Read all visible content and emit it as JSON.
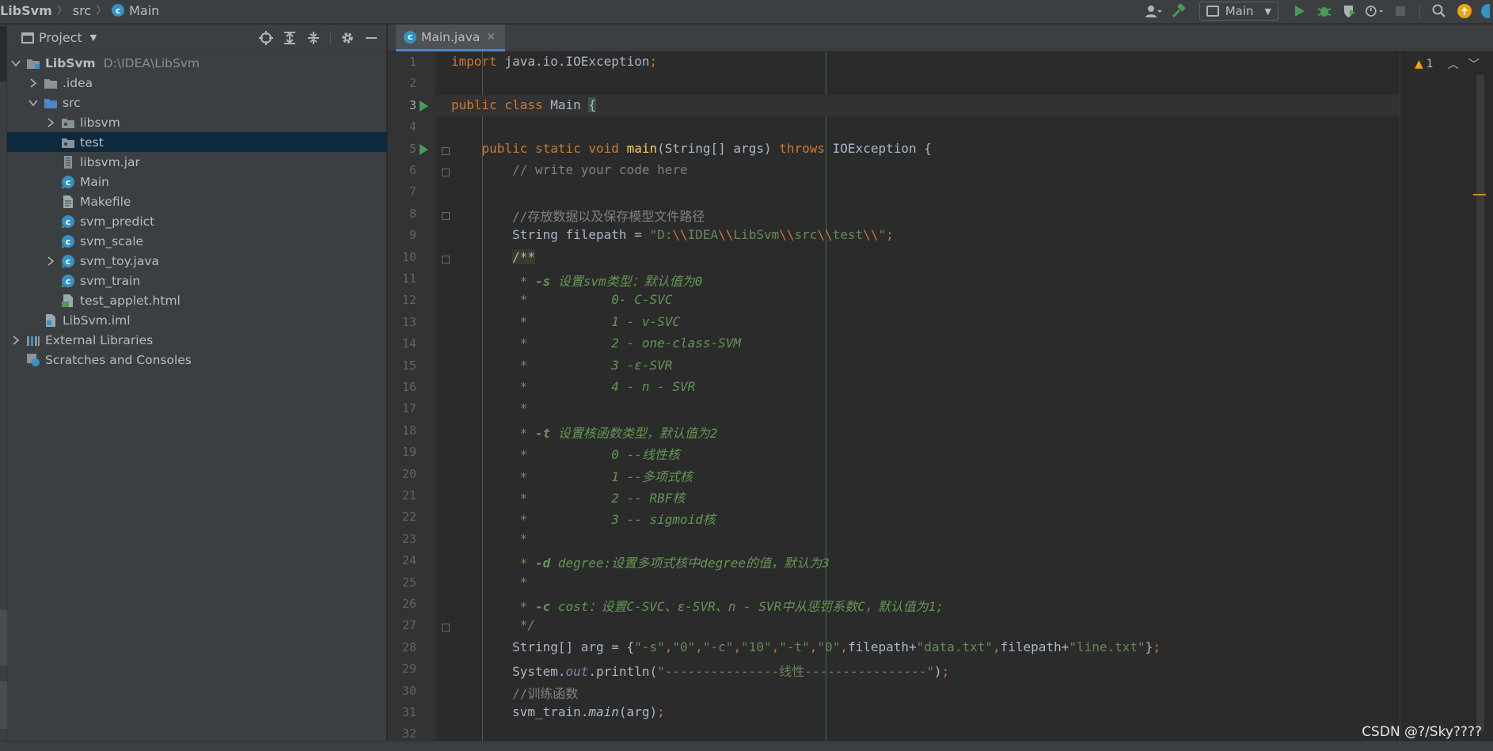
{
  "breadcrumb": {
    "project": "LibSvm",
    "folder": "src",
    "file": "Main"
  },
  "toolbar": {
    "run_config": "Main",
    "colors": {
      "run": "#499c54",
      "debug": "#499c54",
      "build": "#499c54",
      "update": "#f0a30a"
    }
  },
  "project_panel": {
    "title": "Project",
    "tree": [
      {
        "label": "LibSvm",
        "sub": "D:\\IDEA\\LibSvm",
        "depth": 0,
        "arrow": "down",
        "icon": "folder-module-icon",
        "bold": true
      },
      {
        "label": ".idea",
        "depth": 1,
        "arrow": "right",
        "icon": "folder-icon"
      },
      {
        "label": "src",
        "depth": 1,
        "arrow": "down",
        "icon": "source-folder-icon"
      },
      {
        "label": "libsvm",
        "depth": 2,
        "arrow": "right",
        "icon": "package-icon"
      },
      {
        "label": "test",
        "depth": 2,
        "arrow": "",
        "icon": "package-icon",
        "selected": true
      },
      {
        "label": "libsvm.jar",
        "depth": 2,
        "arrow": "",
        "icon": "jar-icon"
      },
      {
        "label": "Main",
        "depth": 2,
        "arrow": "",
        "icon": "java-class-icon"
      },
      {
        "label": "Makefile",
        "depth": 2,
        "arrow": "",
        "icon": "text-file-icon"
      },
      {
        "label": "svm_predict",
        "depth": 2,
        "arrow": "",
        "icon": "java-class-icon"
      },
      {
        "label": "svm_scale",
        "depth": 2,
        "arrow": "",
        "icon": "java-class-icon"
      },
      {
        "label": "svm_toy.java",
        "depth": 2,
        "arrow": "right",
        "icon": "java-class-icon"
      },
      {
        "label": "svm_train",
        "depth": 2,
        "arrow": "",
        "icon": "java-class-icon"
      },
      {
        "label": "test_applet.html",
        "depth": 2,
        "arrow": "",
        "icon": "html-file-icon"
      },
      {
        "label": "LibSvm.iml",
        "depth": 1,
        "arrow": "",
        "icon": "iml-file-icon"
      },
      {
        "label": "External Libraries",
        "depth": 0,
        "arrow": "right",
        "icon": "library-icon"
      },
      {
        "label": "Scratches and Consoles",
        "depth": 0,
        "arrow": "",
        "icon": "scratches-icon"
      }
    ]
  },
  "editor": {
    "tab": "Main.java",
    "warnings": "1",
    "current_line": 3,
    "lines": [
      [
        [
          "kw",
          "import "
        ],
        [
          "",
          "java.io.IOException"
        ],
        [
          "kw",
          ";"
        ]
      ],
      [],
      [
        [
          "kw",
          "public class "
        ],
        [
          "",
          "Main "
        ],
        [
          "hl",
          "{"
        ]
      ],
      [],
      [
        [
          "",
          "    "
        ],
        [
          "kw",
          "public static void "
        ],
        [
          "fn",
          "main"
        ],
        [
          "",
          "(String[] args) "
        ],
        [
          "kw",
          "throws "
        ],
        [
          "",
          "IOException {"
        ]
      ],
      [
        [
          "",
          "        "
        ],
        [
          "cmt",
          "// write your code here"
        ]
      ],
      [],
      [
        [
          "",
          "        "
        ],
        [
          "cmt",
          "//存放数据以及保存模型文件路径"
        ]
      ],
      [
        [
          "",
          "        String filepath = "
        ],
        [
          "str",
          "\"D:"
        ],
        [
          "esc",
          "\\\\"
        ],
        [
          "str",
          "IDEA"
        ],
        [
          "esc",
          "\\\\"
        ],
        [
          "str",
          "LibSvm"
        ],
        [
          "esc",
          "\\\\"
        ],
        [
          "str",
          "src"
        ],
        [
          "esc",
          "\\\\"
        ],
        [
          "str",
          "test"
        ],
        [
          "esc",
          "\\\\"
        ],
        [
          "str",
          "\""
        ],
        [
          "kw",
          ";"
        ]
      ],
      [
        [
          "",
          "        "
        ],
        [
          "dochl",
          "/**"
        ]
      ],
      [
        [
          "",
          "         "
        ],
        [
          "doc",
          "* "
        ],
        [
          "doct",
          "-s"
        ],
        [
          "doc",
          " 设置svm类型：默认值为0"
        ]
      ],
      [
        [
          "",
          "         "
        ],
        [
          "doc",
          "*           0- C-SVC"
        ]
      ],
      [
        [
          "",
          "         "
        ],
        [
          "doc",
          "*           1 - v-SVC"
        ]
      ],
      [
        [
          "",
          "         "
        ],
        [
          "doc",
          "*           2 - one-class-SVM"
        ]
      ],
      [
        [
          "",
          "         "
        ],
        [
          "doc",
          "*           3 -ε-SVR"
        ]
      ],
      [
        [
          "",
          "         "
        ],
        [
          "doc",
          "*           4 - n - SVR"
        ]
      ],
      [
        [
          "",
          "         "
        ],
        [
          "doc",
          "*"
        ]
      ],
      [
        [
          "",
          "         "
        ],
        [
          "doc",
          "* "
        ],
        [
          "doct",
          "-t"
        ],
        [
          "doc",
          " 设置核函数类型，默认值为2"
        ]
      ],
      [
        [
          "",
          "         "
        ],
        [
          "doc",
          "*           0 --线性核"
        ]
      ],
      [
        [
          "",
          "         "
        ],
        [
          "doc",
          "*           1 --多项式核"
        ]
      ],
      [
        [
          "",
          "         "
        ],
        [
          "doc",
          "*           2 -- RBF核"
        ]
      ],
      [
        [
          "",
          "         "
        ],
        [
          "doc",
          "*           3 -- sigmoid核"
        ]
      ],
      [
        [
          "",
          "         "
        ],
        [
          "doc",
          "*"
        ]
      ],
      [
        [
          "",
          "         "
        ],
        [
          "doc",
          "* "
        ],
        [
          "doct",
          "-d"
        ],
        [
          "doc",
          " degree:设置多项式核中degree的值，默认为3"
        ]
      ],
      [
        [
          "",
          "         "
        ],
        [
          "doc",
          "*"
        ]
      ],
      [
        [
          "",
          "         "
        ],
        [
          "doc",
          "* "
        ],
        [
          "doct",
          "-c"
        ],
        [
          "doc",
          " cost：设置C-SVC、ε-SVR、n - SVR中从惩罚系数C，默认值为1;"
        ]
      ],
      [
        [
          "",
          "         "
        ],
        [
          "doc",
          "*/"
        ]
      ],
      [
        [
          "",
          "        String[] arg = {"
        ],
        [
          "str",
          "\"-s\""
        ],
        [
          "kw",
          ","
        ],
        [
          "str",
          "\"0\""
        ],
        [
          "kw",
          ","
        ],
        [
          "str",
          "\"-c\""
        ],
        [
          "kw",
          ","
        ],
        [
          "str",
          "\"10\""
        ],
        [
          "kw",
          ","
        ],
        [
          "str",
          "\"-t\""
        ],
        [
          "kw",
          ","
        ],
        [
          "str",
          "\"0\""
        ],
        [
          "kw",
          ","
        ],
        [
          "",
          "filepath+"
        ],
        [
          "str",
          "\"data.txt\""
        ],
        [
          "kw",
          ","
        ],
        [
          "",
          "filepath+"
        ],
        [
          "str",
          "\"line.txt\""
        ],
        [
          "",
          "}"
        ],
        [
          "kw",
          ";"
        ]
      ],
      [
        [
          "",
          "        System."
        ],
        [
          "fld",
          "out"
        ],
        [
          "",
          ".println("
        ],
        [
          "str",
          "\"---------------线性----------------\""
        ],
        [
          "",
          ")"
        ],
        [
          "kw",
          ";"
        ]
      ],
      [
        [
          "",
          "        "
        ],
        [
          "cmt",
          "//训练函数"
        ]
      ],
      [
        [
          "",
          "        svm_train."
        ],
        [
          "st",
          "main"
        ],
        [
          "",
          "(arg)"
        ],
        [
          "kw",
          ";"
        ]
      ],
      []
    ]
  },
  "watermark": "CSDN @?/Sky????"
}
